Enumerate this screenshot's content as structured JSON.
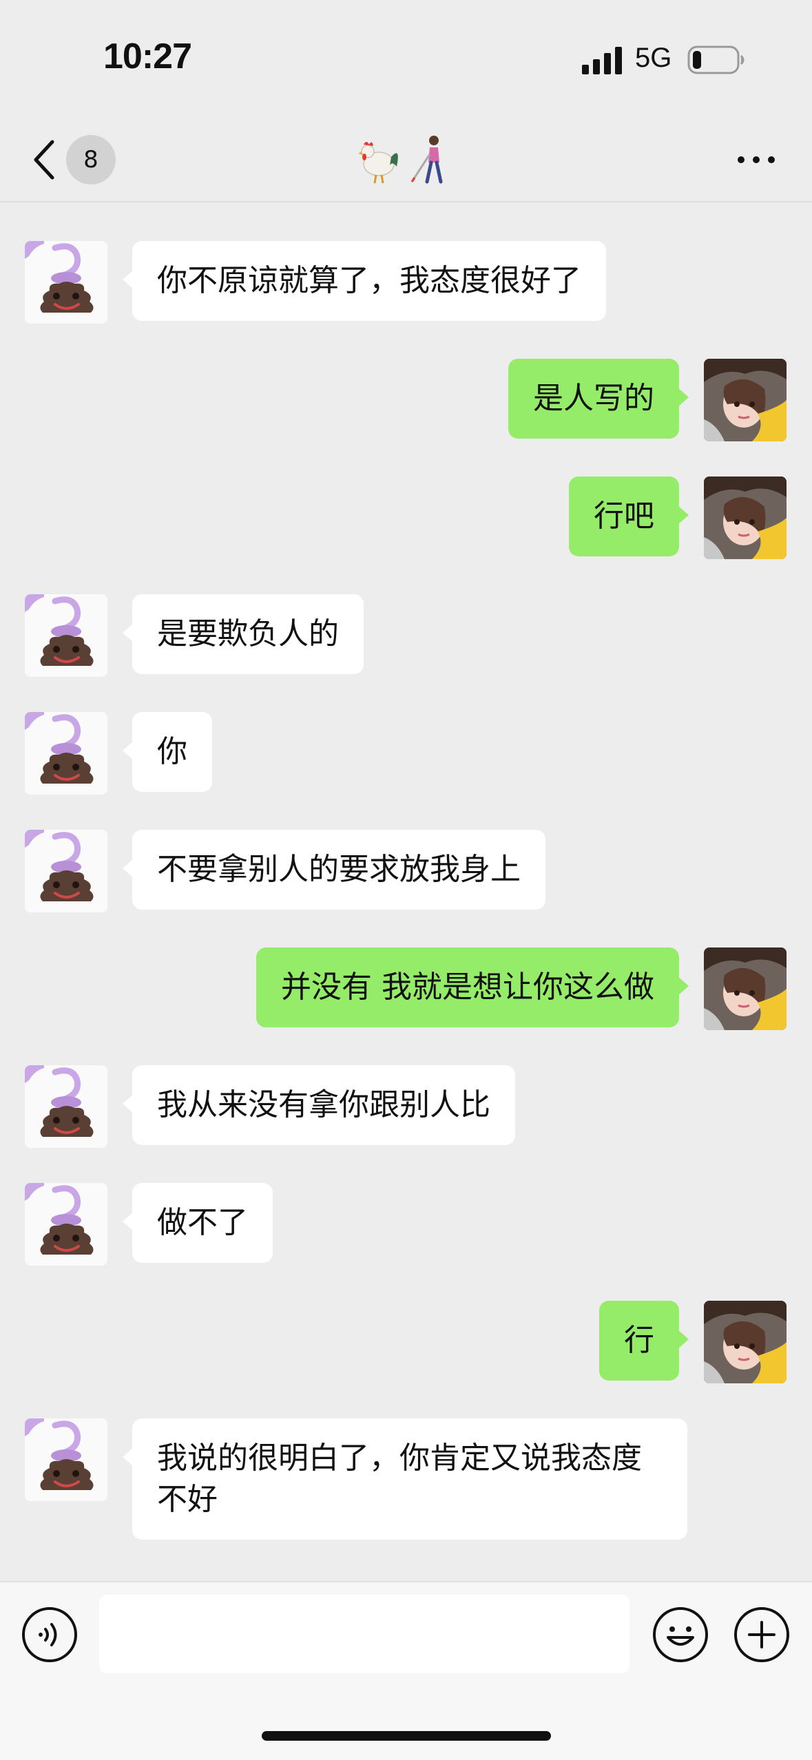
{
  "status_bar": {
    "time": "10:27",
    "network": "5G"
  },
  "nav": {
    "unread_count": "8",
    "title_icons": [
      "rooster-emoji",
      "person-with-white-cane-emoji"
    ]
  },
  "messages": [
    {
      "side": "recv",
      "text": "你不原谅就算了，我态度很好了"
    },
    {
      "side": "sent",
      "text": "是人写的"
    },
    {
      "side": "sent",
      "text": "行吧"
    },
    {
      "side": "recv",
      "text": "是要欺负人的"
    },
    {
      "side": "recv",
      "text": "你"
    },
    {
      "side": "recv",
      "text": "不要拿别人的要求放我身上"
    },
    {
      "side": "sent",
      "text": "并没有 我就是想让你这么做"
    },
    {
      "side": "recv",
      "text": "我从来没有拿你跟别人比"
    },
    {
      "side": "recv",
      "text": "做不了"
    },
    {
      "side": "sent",
      "text": "行"
    },
    {
      "side": "recv",
      "text": "我说的很明白了，你肯定又说我态度不好"
    }
  ],
  "input": {
    "value": "",
    "placeholder": ""
  },
  "colors": {
    "sent_bubble": "#95ec69",
    "recv_bubble": "#ffffff",
    "background": "#ededed"
  }
}
